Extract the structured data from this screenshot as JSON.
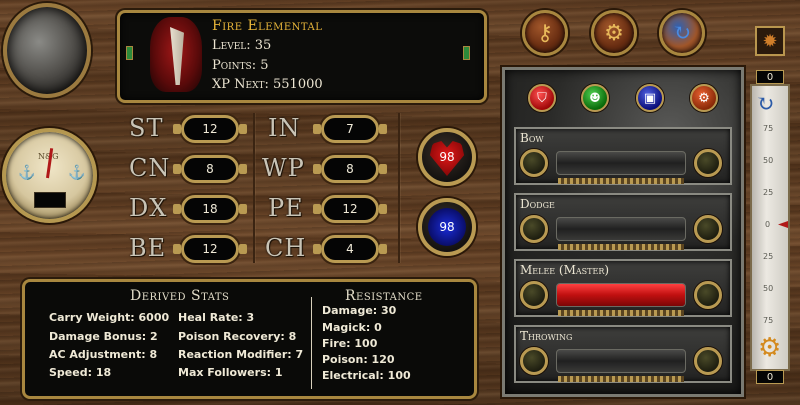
{
  "character": {
    "name": "Fire Elemental",
    "level_label": "Level: 35",
    "points_label": "Points: 5",
    "xp_label": "XP Next: 551000"
  },
  "gauge": {
    "text": "N&G"
  },
  "stats": [
    {
      "abbr": "ST",
      "value": "12"
    },
    {
      "abbr": "CN",
      "value": "8"
    },
    {
      "abbr": "DX",
      "value": "18"
    },
    {
      "abbr": "BE",
      "value": "12"
    },
    {
      "abbr": "IN",
      "value": "7"
    },
    {
      "abbr": "WP",
      "value": "8"
    },
    {
      "abbr": "PE",
      "value": "12"
    },
    {
      "abbr": "CH",
      "value": "4"
    }
  ],
  "hp": "98",
  "fatigue": "98",
  "derived": {
    "title": "Derived Stats",
    "left": [
      "Carry Weight: 6000",
      "Damage Bonus: 2",
      "AC Adjustment: 8",
      "Speed: 18"
    ],
    "middle": [
      "Heal Rate: 3",
      "Poison Recovery: 8",
      "Reaction Modifier: 7",
      "Max Followers: 1"
    ]
  },
  "resistance": {
    "title": "Resistance",
    "lines": [
      "Damage: 30",
      "Magick: 0",
      "Fire: 100",
      "Poison: 120",
      "Electrical: 100"
    ]
  },
  "skills": [
    {
      "name": "Bow",
      "fill": 0
    },
    {
      "name": "Dodge",
      "fill": 0
    },
    {
      "name": "Melee (Master)",
      "fill": 1.0
    },
    {
      "name": "Throwing",
      "fill": 0
    }
  ],
  "ruler": {
    "top_counter": "0",
    "bottom_counter": "0",
    "center_label": "0",
    "numbers": [
      "75",
      "50",
      "25",
      "25",
      "50",
      "75"
    ]
  },
  "colors": {
    "gold_text": "#e7b53a",
    "brass": "#a8873f",
    "hp_red": "#e01818",
    "fatigue_blue": "#1a2cd8"
  },
  "icons": {
    "tab_skills": "key-icon",
    "tab_spells": "gear-icon",
    "tab_tech": "cycle-icon",
    "gem_red": "shield-icon",
    "gem_green": "mask-icon",
    "gem_blue": "hat-icon",
    "gem_orange": "gear-icon"
  }
}
